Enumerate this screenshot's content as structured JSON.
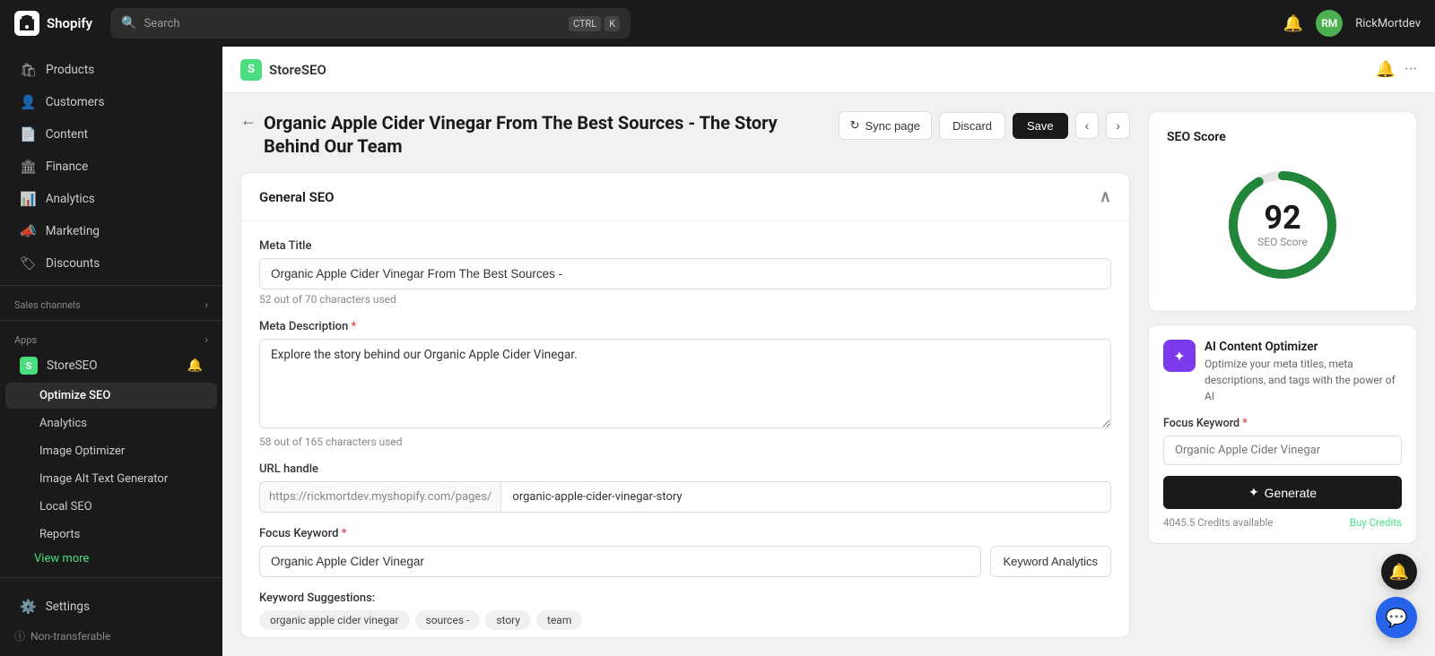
{
  "app": {
    "name": "Shopify",
    "search_placeholder": "Search",
    "search_shortcut_ctrl": "CTRL",
    "search_shortcut_key": "K",
    "username": "RickMortdev"
  },
  "sidebar": {
    "main_items": [
      {
        "id": "products",
        "label": "Products",
        "icon": "🛍"
      },
      {
        "id": "customers",
        "label": "Customers",
        "icon": "👤"
      },
      {
        "id": "content",
        "label": "Content",
        "icon": "📄"
      },
      {
        "id": "finance",
        "label": "Finance",
        "icon": "🏛"
      },
      {
        "id": "analytics",
        "label": "Analytics",
        "icon": "📊"
      },
      {
        "id": "marketing",
        "label": "Marketing",
        "icon": "📣"
      },
      {
        "id": "discounts",
        "label": "Discounts",
        "icon": "🏷"
      }
    ],
    "sales_channels_label": "Sales channels",
    "apps_label": "Apps",
    "app_name": "StoreSEO",
    "sub_items": [
      {
        "id": "optimize-seo",
        "label": "Optimize SEO",
        "active": true
      },
      {
        "id": "analytics",
        "label": "Analytics"
      },
      {
        "id": "image-optimizer",
        "label": "Image Optimizer"
      },
      {
        "id": "image-alt-text",
        "label": "Image Alt Text Generator"
      },
      {
        "id": "local-seo",
        "label": "Local SEO"
      },
      {
        "id": "reports",
        "label": "Reports"
      }
    ],
    "view_more": "View more",
    "settings": "Settings",
    "non_transferable": "Non-transferable"
  },
  "storeseo": {
    "name": "StoreSEO"
  },
  "page": {
    "title": "Organic Apple Cider Vinegar From The Best Sources - The Story Behind Our Team",
    "sync_label": "Sync page",
    "discard_label": "Discard",
    "save_label": "Save"
  },
  "general_seo": {
    "section_title": "General SEO",
    "meta_title_label": "Meta Title",
    "meta_title_value": "Organic Apple Cider Vinegar From The Best Sources -",
    "meta_title_char_count": "52 out of 70 characters used",
    "meta_description_label": "Meta Description",
    "meta_description_required": true,
    "meta_description_value": "Explore the story behind our Organic Apple Cider Vinegar.",
    "meta_description_char_count": "58 out of 165 characters used",
    "url_handle_label": "URL handle",
    "url_prefix": "https://rickmortdev.myshopify.com/pages/",
    "url_suffix": "organic-apple-cider-vinegar-story",
    "focus_keyword_label": "Focus Keyword",
    "focus_keyword_required": true,
    "focus_keyword_value": "Organic Apple Cider Vinegar",
    "keyword_analytics_btn": "Keyword Analytics",
    "keyword_suggestions_label": "Keyword Suggestions:",
    "keyword_tags": [
      "organic apple cider vinegar",
      "sources -",
      "story",
      "team"
    ]
  },
  "seo_score": {
    "section_title": "SEO Score",
    "score": "92",
    "score_label": "SEO Score",
    "score_value": 92,
    "score_max": 100,
    "score_color": "#22863a",
    "track_color": "#e5e5e5"
  },
  "ai_optimizer": {
    "title": "AI Content Optimizer",
    "description": "Optimize your meta titles, meta descriptions, and tags with the power of AI",
    "focus_keyword_label": "Focus Keyword",
    "focus_keyword_required": true,
    "focus_keyword_placeholder": "Organic Apple Cider Vinegar",
    "generate_btn": "Generate",
    "credits_text": "4045.5 Credits available",
    "buy_credits_label": "Buy Credits"
  }
}
